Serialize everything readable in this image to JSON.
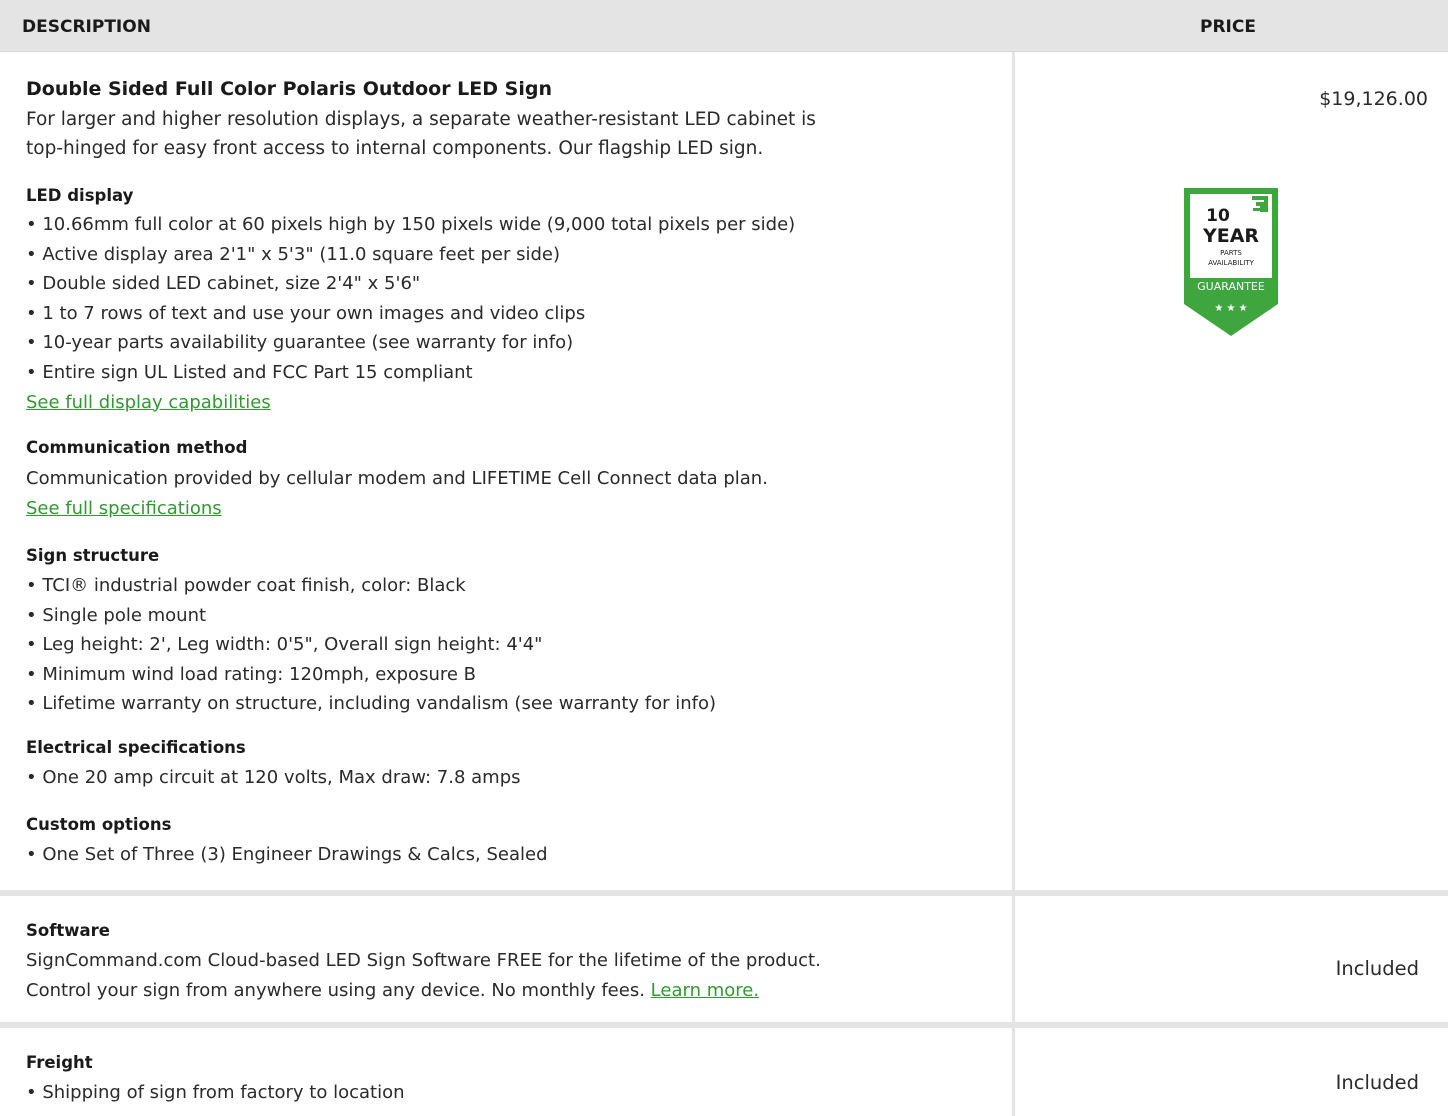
{
  "header": {
    "description": "DESCRIPTION",
    "price": "PRICE"
  },
  "product": {
    "title": "Double Sided Full Color Polaris Outdoor LED Sign",
    "description_line1": "For larger and higher resolution displays, a separate weather-resistant LED cabinet is",
    "description_line2": "top-hinged for easy front access to internal components. Our flagship LED sign.",
    "price": "$19,126.00",
    "badge": {
      "number": "10",
      "word": "YEAR",
      "line1": "PARTS",
      "line2": "AVAILABILITY",
      "ribbon": "GUARANTEE",
      "stars": "★ ★ ★",
      "color": "#3fa63f"
    }
  },
  "led_display": {
    "title": "LED display",
    "items": [
      "• 10.66mm full color at 60 pixels high by 150 pixels wide (9,000 total pixels per side)",
      "• Active display area 2'1\" x 5'3\" (11.0 square feet per side)",
      "• Double sided LED cabinet, size 2'4\" x 5'6\"",
      "• 1 to 7 rows of text and use your own images and video clips",
      "• 10-year parts availability guarantee (see warranty for info)",
      "• Entire sign UL Listed and FCC Part 15 compliant"
    ],
    "link": "See full display capabilities"
  },
  "communication": {
    "title": "Communication method",
    "text": "Communication provided by cellular modem and LIFETIME Cell Connect data plan.",
    "link": "See full specifications"
  },
  "structure": {
    "title": "Sign structure",
    "items": [
      "• TCI® industrial powder coat finish, color: Black",
      "• Single pole mount",
      "• Leg height: 2', Leg width: 0'5\", Overall sign height: 4'4\"",
      "• Minimum wind load rating: 120mph, exposure B",
      "• Lifetime warranty on structure, including vandalism (see warranty for info)"
    ]
  },
  "electrical": {
    "title": "Electrical specifications",
    "items": [
      "• One 20 amp circuit at 120 volts, Max draw: 7.8 amps"
    ]
  },
  "custom": {
    "title": "Custom options",
    "items": [
      "• One Set of Three (3) Engineer Drawings & Calcs, Sealed"
    ]
  },
  "software": {
    "title": "Software",
    "line1": "SignCommand.com Cloud-based LED Sign Software FREE for the lifetime of the product.",
    "line2": "Control your sign from anywhere using any device. No monthly fees.",
    "link": "Learn more.",
    "price": "Included"
  },
  "freight": {
    "title": "Freight",
    "items": [
      "• Shipping of sign from factory to location"
    ],
    "price": "Included"
  },
  "colors": {
    "accent_green": "#2f9a2f",
    "header_bg": "#e4e4e4"
  }
}
